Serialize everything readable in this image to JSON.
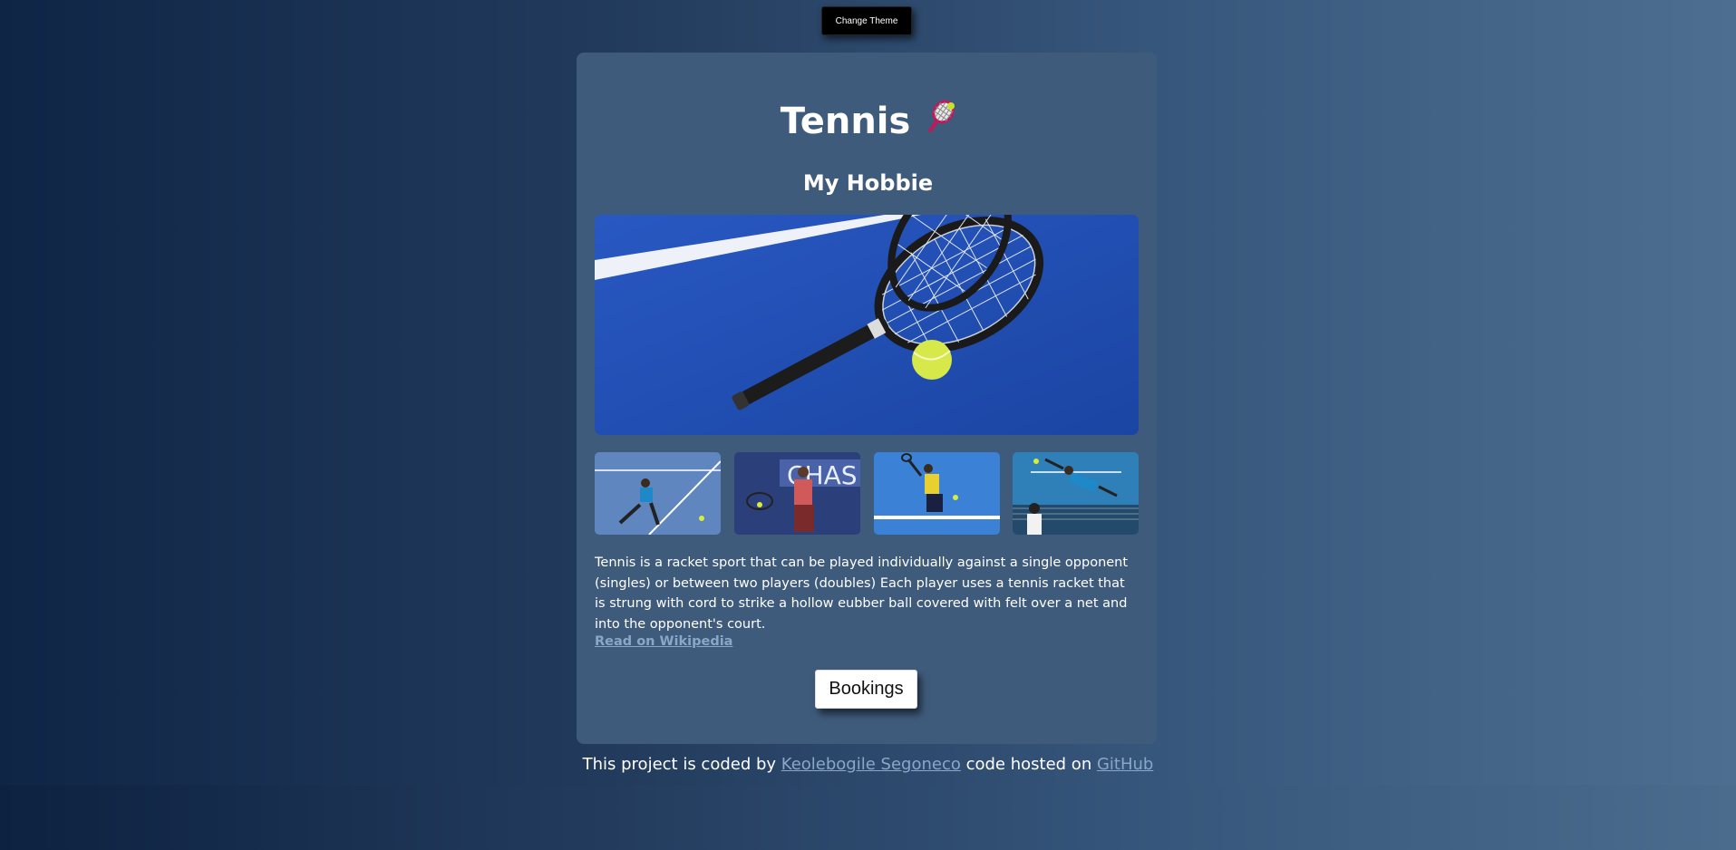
{
  "header": {
    "theme_button_label": "Change Theme"
  },
  "card": {
    "title": "Tennis",
    "title_emoji": "🎾",
    "subtitle": "My Hobbie",
    "description": "Tennis is a racket sport that can be played individually against a single opponent (singles) or between two players (doubles) Each player uses a tennis racket that is strung with cord to strike a hollow eubber ball covered with felt over a net and into the opponent's court.",
    "wiki_link": "Read on Wikipedia",
    "bookings_label": "Bookings"
  },
  "footer": {
    "prefix": "This project is coded by",
    "author_link": "Keolebogile Segoneco",
    "middle": "code hosted on",
    "repo_link": "GitHub"
  },
  "colors": {
    "card_bg": "#3f5b7b",
    "link": "#8aa6c8",
    "court_blue": "#1f4fb0"
  }
}
